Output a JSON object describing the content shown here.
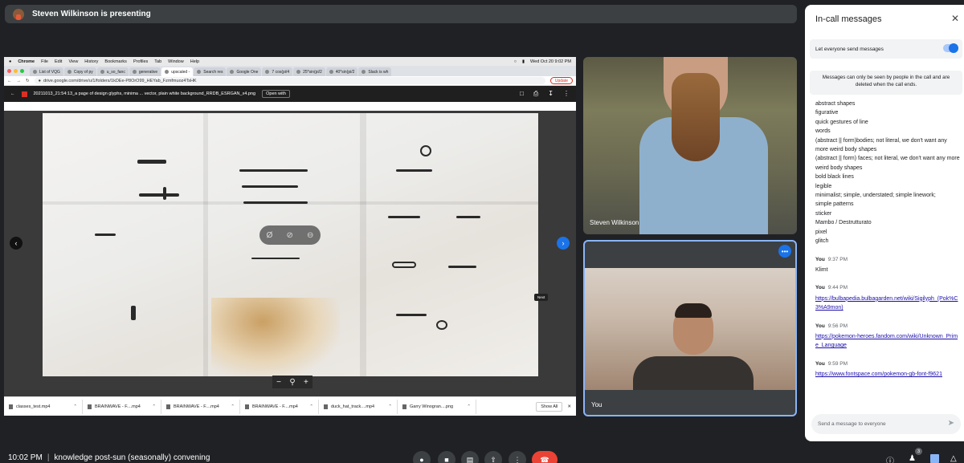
{
  "presenter_bar": {
    "text": "Steven Wilkinson is presenting"
  },
  "shared_screen": {
    "menubar": {
      "app": "Chrome",
      "items": [
        "File",
        "Edit",
        "View",
        "History",
        "Bookmarks",
        "Profiles",
        "Tab",
        "Window",
        "Help"
      ],
      "clock": "Wed Oct 20  9:02 PM"
    },
    "tabs": [
      "List of VQG",
      "Copy of py",
      "u_so_fanc",
      "generative",
      "upscaled -",
      "Search res",
      "Google One",
      "7 cos(pi/4",
      "25*sin(pi/2",
      "40*sin(pi/2",
      "Slack is wh"
    ],
    "address": {
      "url": "drive.google.com/drive/u/1/folders/1kDEe-P8OrO99_HEYab_Fzmfmuoz4TsHK",
      "update_label": "Update"
    },
    "viewer": {
      "filename": "20211013_21:54:13_a page of design glyphs, minima ... vector, plain white background_RRDB_ESRGAN_x4.png",
      "open_with": "Open with",
      "next_label": "Next"
    },
    "downloads": [
      "classes_test.mp4",
      "BRAINWAVE - F....mp4",
      "BRAINWAVE - F....mp4",
      "BRAINWAVE - F....mp4",
      "duck_hat_track....mp4",
      "Garry Winogran....png"
    ],
    "show_all": "Show All"
  },
  "tiles": {
    "steven": {
      "name": "Steven Wilkinson"
    },
    "you": {
      "name": "You",
      "more": "•••"
    }
  },
  "chat": {
    "title": "In-call messages",
    "toggle_label": "Let everyone send messages",
    "notice": "Messages can only be seen by people in the call and are deleted when the call ends.",
    "prompt_lines": [
      "abstract shapes",
      "figurative",
      "quick gestures of line",
      "words",
      "(abstract || form)bodies; not literal, we don't want any more weird body shapes",
      "(abstract || form) faces; not literal, we don't want any more weird body shapes",
      "bold black lines",
      "legible",
      "minimalist; simple, understated; simple linework;",
      "simple patterns",
      "sticker",
      "Mambo / Destrutturato",
      "pixel",
      "glitch"
    ],
    "messages": [
      {
        "sender": "You",
        "time": "9:37 PM",
        "text": "Klimt"
      },
      {
        "sender": "You",
        "time": "9:44 PM",
        "text": "https://bulbapedia.bulbagarden.net/wiki/Sigilyph_(Pok%C3%A9mon)"
      },
      {
        "sender": "You",
        "time": "9:56 PM",
        "text": "https://pokemon-heroes.fandom.com/wiki/Unknown_Prime_Language"
      },
      {
        "sender": "You",
        "time": "9:59 PM",
        "text": "https://www.fontspace.com/pokemon-gb-font-f9621"
      }
    ],
    "input_placeholder": "Send a message to everyone"
  },
  "bottom_bar": {
    "time": "10:02 PM",
    "meeting_name": "knowledge post-sun (seasonally) convening",
    "participants_count": "3"
  }
}
